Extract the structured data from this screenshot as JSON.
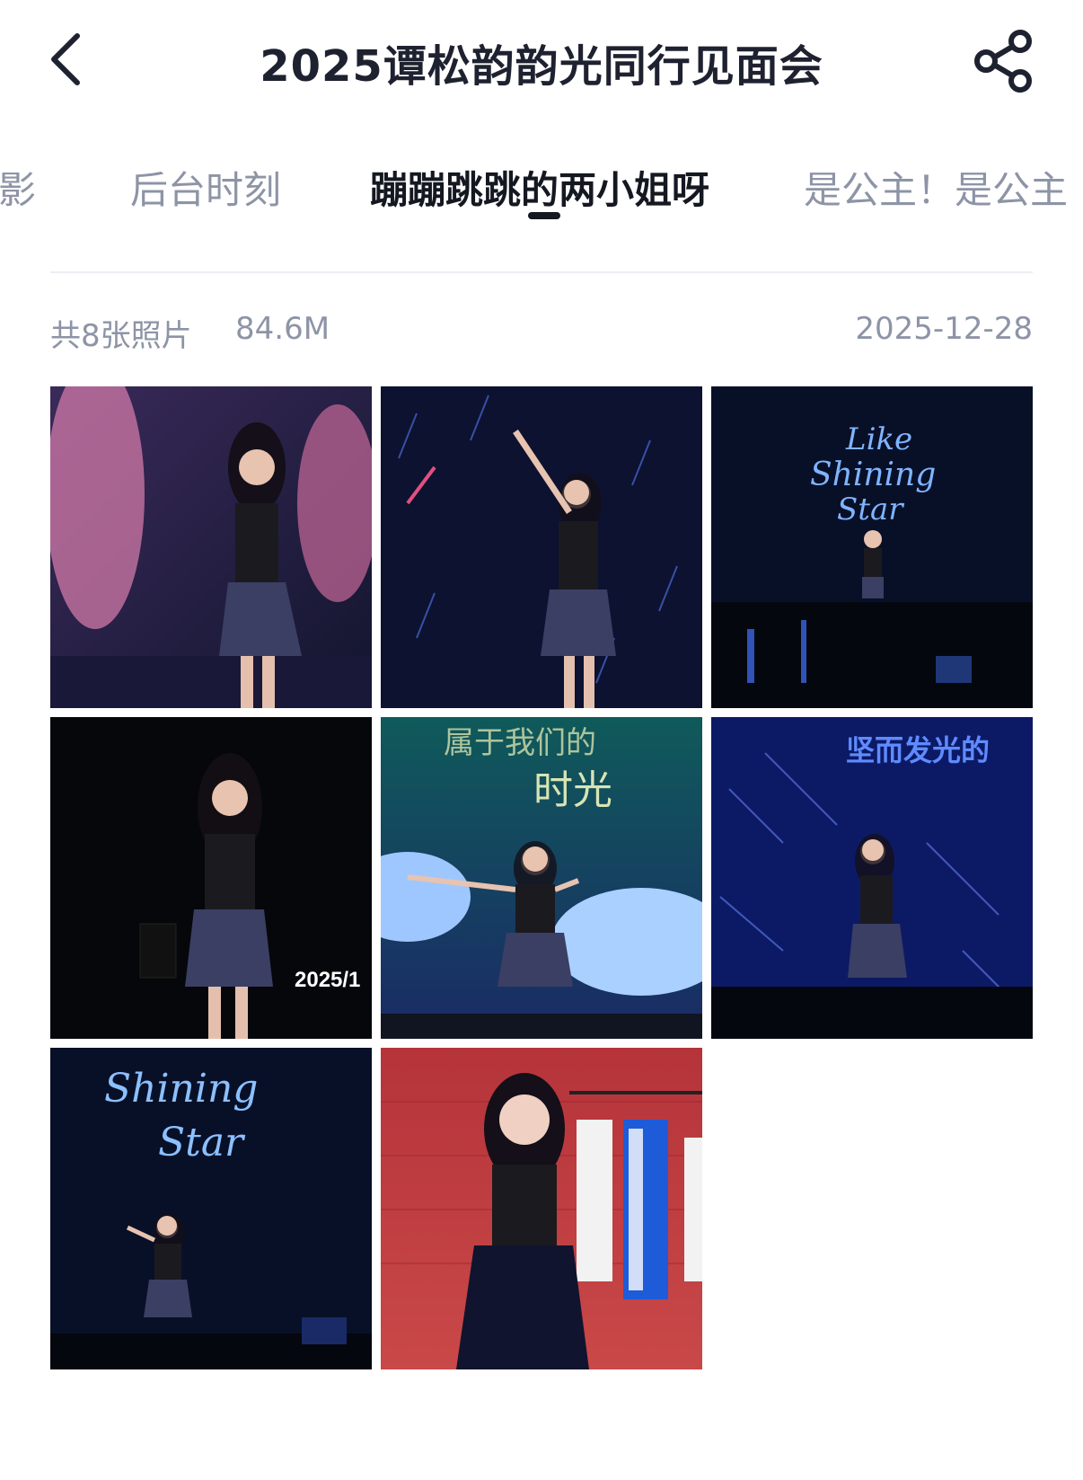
{
  "header": {
    "title": "2025谭松韵韵光同行见面会",
    "back_icon": "chevron-left-icon",
    "share_icon": "share-icon"
  },
  "tabs": [
    {
      "label": "合影",
      "active": false
    },
    {
      "label": "后台时刻",
      "active": false
    },
    {
      "label": "蹦蹦跳跳的两小姐呀",
      "active": true
    },
    {
      "label": "是公主！是公主",
      "active": false
    }
  ],
  "meta": {
    "count": "共8张照片",
    "size": "84.6M",
    "date": "2025-12-28"
  },
  "photos": [
    {
      "overlay_text": ""
    },
    {
      "overlay_text": ""
    },
    {
      "overlay_text": "Like Shining Star"
    },
    {
      "overlay_text": "2025/1"
    },
    {
      "overlay_text": "属于我们的 时光"
    },
    {
      "overlay_text": "坚而发光的"
    },
    {
      "overlay_text": "Shining Star"
    },
    {
      "overlay_text": ""
    }
  ],
  "colors": {
    "title": "#1e2230",
    "tab_inactive": "#8d94a6",
    "tab_active": "#141821",
    "meta": "#8d94a6"
  }
}
